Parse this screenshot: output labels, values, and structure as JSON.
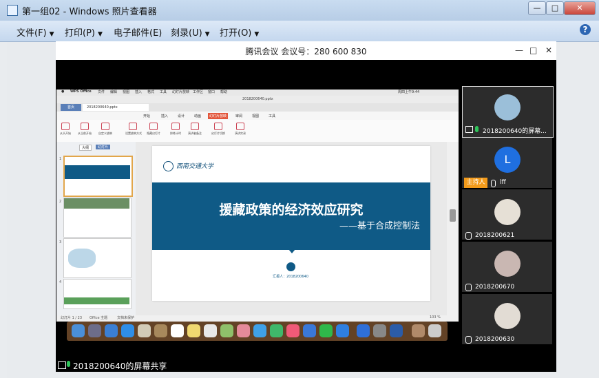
{
  "window": {
    "title": "第一组02 - Windows 照片查看器",
    "minimize": "—",
    "maximize": "□",
    "close": "✕"
  },
  "menu": [
    {
      "label": "文件(F)"
    },
    {
      "label": "打印(P)"
    },
    {
      "label": "电子邮件(E)"
    },
    {
      "label": "刻录(U)"
    },
    {
      "label": "打开(O)"
    }
  ],
  "help_icon": "?",
  "meeting": {
    "title": "腾讯会议 会议号：280 600 830",
    "minimize": "—",
    "maximize": "□",
    "close": "✕"
  },
  "shared_screen": {
    "mac_menu": [
      "WPS Office",
      "文件",
      "编辑",
      "视图",
      "插入",
      "格式",
      "工具",
      "幻灯片放映",
      "工作区",
      "窗口",
      "帮助"
    ],
    "mac_status": "周四上午9:44",
    "filename": "2018200640.pptx",
    "tab_home": "首页",
    "tab_file": "2018200640.pptx",
    "ribbon_tabs": [
      "开始",
      "插入",
      "设计",
      "动画",
      "幻灯片放映",
      "审阅",
      "视图",
      "工具"
    ],
    "ribbon_buttons": [
      "从头开始",
      "从当前开始",
      "自定义放映",
      "设置放映方式",
      "隐藏幻灯片",
      "排练计时",
      "演讲者备注",
      "幻灯片切换",
      "演讲实录"
    ],
    "panel_tabs": [
      "大纲",
      "幻灯片"
    ],
    "slide": {
      "university": "西南交通大学",
      "title": "援藏政策的经济效应研究",
      "subtitle": "——基于合成控制法",
      "reporter": "汇报人：2018200640"
    },
    "status_left": "幻灯片 1 / 23",
    "status_theme": "Office 主题",
    "status_notes": "文档未保护",
    "zoom": "103 %"
  },
  "share_label": "2018200640的屏幕共享",
  "participants": [
    {
      "name": "2018200640的屏幕...",
      "avatar_color": "#9bbfd9"
    },
    {
      "name": "lff",
      "avatar_letter": "L",
      "avatar_color": "#1f6fe0",
      "badge": "主持人"
    },
    {
      "name": "2018200621",
      "avatar_color": "#e6e0d6"
    },
    {
      "name": "2018200670",
      "avatar_color": "#c9b7b2"
    },
    {
      "name": "2018200630",
      "avatar_color": "#e2dcd4"
    }
  ]
}
